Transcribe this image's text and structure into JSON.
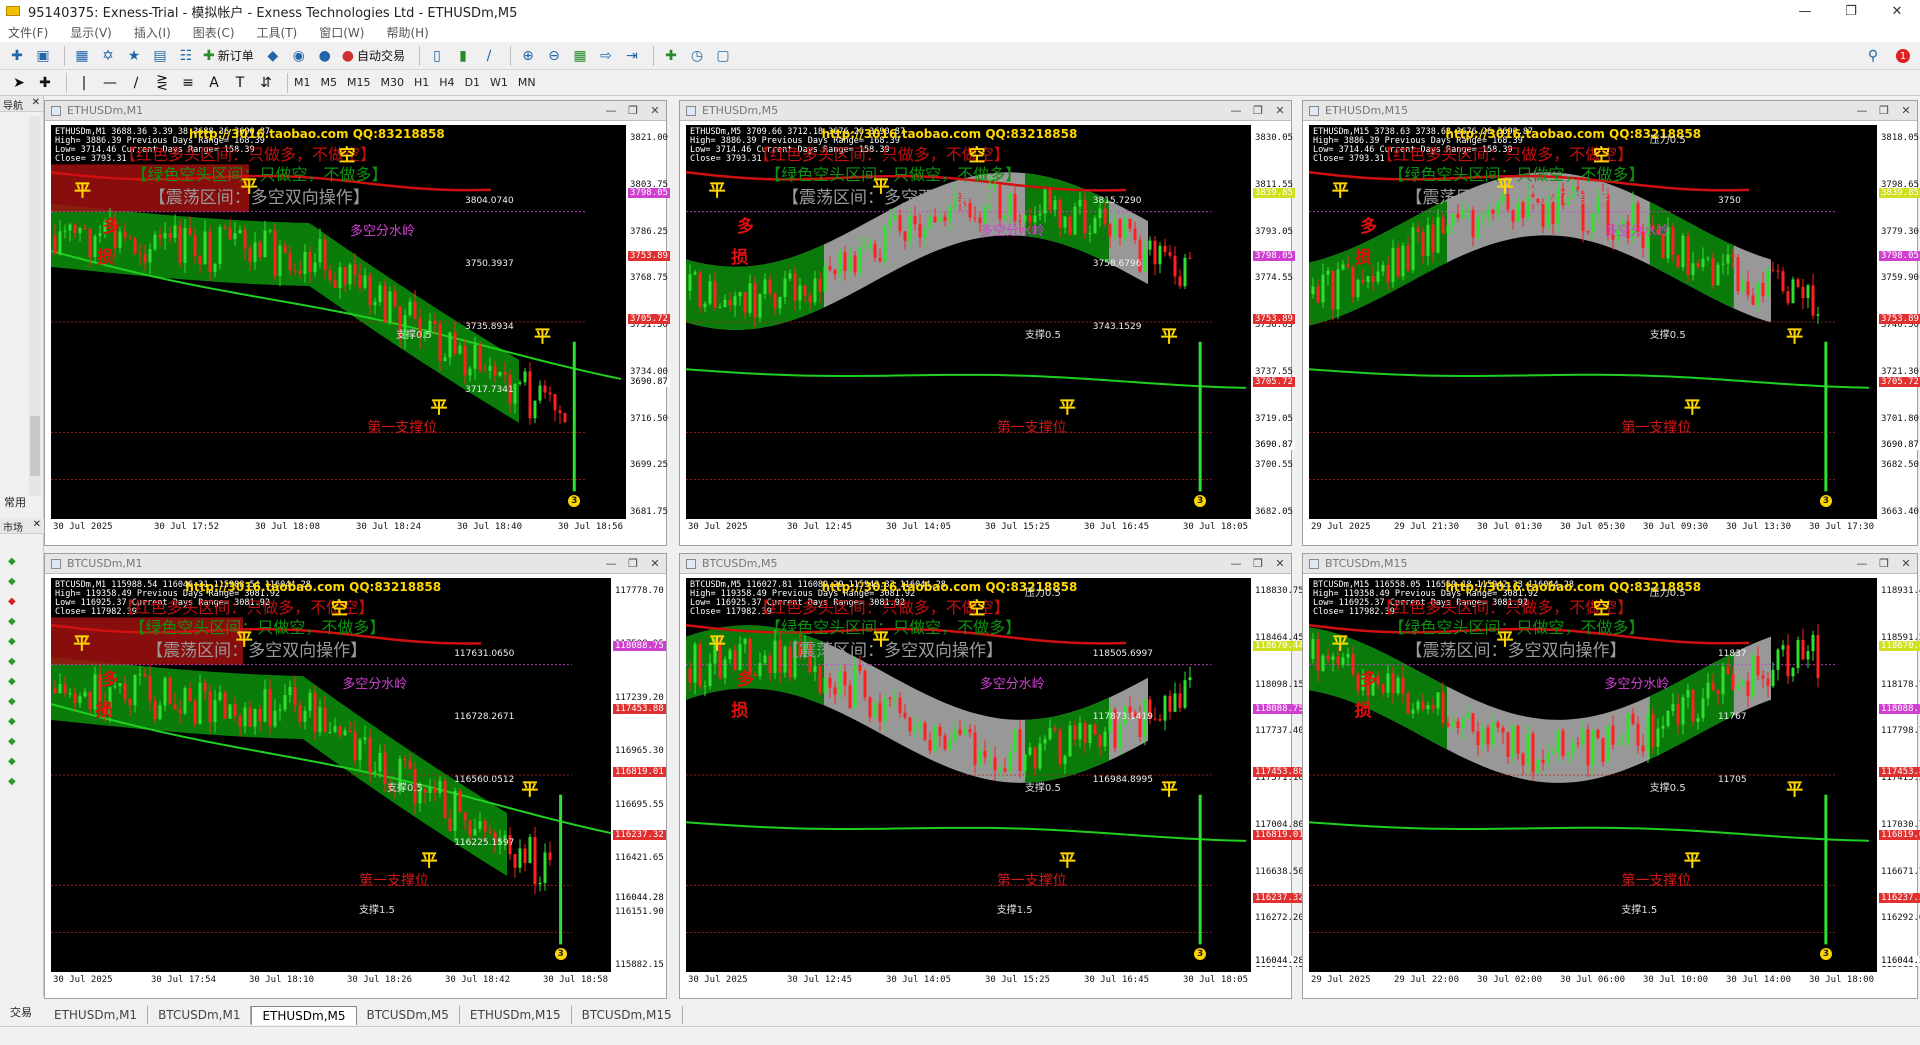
{
  "window": {
    "title": "95140375: Exness-Trial - 模拟帐户 - Exness Technologies Ltd - ETHUSDm,M5"
  },
  "menu": [
    "文件(F)",
    "显示(V)",
    "插入(I)",
    "图表(C)",
    "工具(T)",
    "窗口(W)",
    "帮助(H)"
  ],
  "toolbar": {
    "new_order": "新订单",
    "auto_trade": "自动交易",
    "timeframes": [
      "M1",
      "M5",
      "M15",
      "M30",
      "H1",
      "H4",
      "D1",
      "W1",
      "MN"
    ],
    "notif_count": "1"
  },
  "left": {
    "nav": "导航",
    "common": "常用",
    "market": "市场",
    "trade_tab": "交易"
  },
  "tabs": [
    "ETHUSDm,M1",
    "BTCUSDm,M1",
    "ETHUSDm,M5",
    "BTCUSDm,M5",
    "ETHUSDm,M15",
    "BTCUSDm,M15"
  ],
  "active_tab": "ETHUSDm,M5",
  "common": {
    "url": "http://3016.taobao.com QQ:83218858",
    "red_zone": "【红色多头区间：只做多，不做空】",
    "green_zone": "【绿色空头区间：只做空，不做多】",
    "range_zone": "【震荡区间：多空双向操作】",
    "ping": "平",
    "duo": "多",
    "kong": "空",
    "sun": "损",
    "support05": "支撑0.5",
    "support15": "支撑1.5",
    "pressure05": "压力0.5",
    "first_support": "第一支撑位",
    "ridge": "多空分水岭"
  },
  "charts": [
    {
      "name": "ETHUSDm,M1",
      "ohlc": [
        "ETHUSDm,M1  3688.36 3.39 38 3688.36 3690.87",
        "High= 3886.39   Previous Days Range= 168.39",
        "Low= 3714.46   Current Days Range= 158.39",
        "Close= 3793.31"
      ],
      "yticks": [
        "3821.00",
        "3803.75",
        "3786.25",
        "3768.75",
        "3751.50",
        "3734.00",
        "3716.50",
        "3699.25",
        "3681.75"
      ],
      "xticks": [
        "30 Jul 2025",
        "30 Jul 17:52",
        "30 Jul 18:08",
        "30 Jul 18:24",
        "30 Jul 18:40",
        "30 Jul 18:56"
      ],
      "tags": [
        {
          "v": "3798.05",
          "c": "#d040d0"
        },
        {
          "v": "3753.89",
          "c": "#e03030"
        },
        {
          "v": "3705.72",
          "c": "#e03030"
        },
        {
          "v": "3690.87",
          "c": "#ffffff"
        }
      ],
      "prices": [
        "3804.0740",
        "3750.3937",
        "3735.8934",
        "3717.7341"
      ]
    },
    {
      "name": "ETHUSDm,M5",
      "ohlc": [
        "ETHUSDm,M5  3709.66 3712.18 3676.26 3690.87",
        "High= 3886.39   Previous Days Range= 168.39",
        "Low= 3714.46   Current Days Range= 158.39",
        "Close= 3793.31"
      ],
      "yticks": [
        "3830.05",
        "3811.55",
        "3793.05",
        "3774.55",
        "3756.05",
        "3737.55",
        "3719.05",
        "3700.55",
        "3682.05"
      ],
      "xticks": [
        "30 Jul 2025",
        "30 Jul 12:45",
        "30 Jul 14:05",
        "30 Jul 15:25",
        "30 Jul 16:45",
        "30 Jul 18:05"
      ],
      "tags": [
        {
          "v": "3839.85",
          "c": "#d0e020"
        },
        {
          "v": "3798.05",
          "c": "#d040d0"
        },
        {
          "v": "3753.89",
          "c": "#e03030"
        },
        {
          "v": "3705.72",
          "c": "#e03030"
        },
        {
          "v": "3690.87",
          "c": "#ffffff"
        }
      ],
      "prices": [
        "3815.7290",
        "3758.6796",
        "3743.1529"
      ]
    },
    {
      "name": "ETHUSDm,M15",
      "ohlc": [
        "ETHUSDm,M15  3738.63 3738.63 3676.26 3690.87",
        "High= 3886.39   Previous Days Range= 168.39",
        "Low= 3714.46   Current Days Range= 158.39",
        "Close= 3793.31"
      ],
      "yticks": [
        "3818.05",
        "3798.65",
        "3779.30",
        "3759.90",
        "3740.50",
        "3721.30",
        "3701.80",
        "3682.50",
        "3663.40"
      ],
      "xticks": [
        "29 Jul 2025",
        "29 Jul 21:30",
        "30 Jul 01:30",
        "30 Jul 05:30",
        "30 Jul 09:30",
        "30 Jul 13:30",
        "30 Jul 17:30"
      ],
      "tags": [
        {
          "v": "3839.85",
          "c": "#d0e020"
        },
        {
          "v": "3798.05",
          "c": "#d040d0"
        },
        {
          "v": "3753.89",
          "c": "#e03030"
        },
        {
          "v": "3705.72",
          "c": "#e03030"
        },
        {
          "v": "3690.87",
          "c": "#ffffff"
        }
      ],
      "prices": [
        "3750"
      ]
    },
    {
      "name": "BTCUSDm,M1",
      "ohlc": [
        "BTCUSDm,M1  115988.54 116046.31 115988.54 116044.28",
        "High= 119358.49   Previous Days Range= 3081.92",
        "Low= 116925.37   Current Days Range= 3081.92",
        "Close= 117982.39"
      ],
      "yticks": [
        "117778.70",
        "117508.95",
        "117239.20",
        "116965.30",
        "116695.55",
        "116421.65",
        "116151.90",
        "115882.15"
      ],
      "xticks": [
        "30 Jul 2025",
        "30 Jul 17:54",
        "30 Jul 18:10",
        "30 Jul 18:26",
        "30 Jul 18:42",
        "30 Jul 18:58"
      ],
      "tags": [
        {
          "v": "118088.75",
          "c": "#d040d0"
        },
        {
          "v": "117453.88",
          "c": "#e03030"
        },
        {
          "v": "116819.01",
          "c": "#e03030"
        },
        {
          "v": "116237.32",
          "c": "#e03030"
        },
        {
          "v": "116044.28",
          "c": "#ffffff"
        }
      ],
      "prices": [
        "117631.0650",
        "116728.2671",
        "116560.0512",
        "116225.1597"
      ]
    },
    {
      "name": "BTCUSDm,M5",
      "ohlc": [
        "BTCUSDm,M5  116027.81 116089.29 115942.33 116044.28",
        "High= 119358.49   Previous Days Range= 3081.92",
        "Low= 116925.37   Current Days Range= 3081.92",
        "Close= 117982.39"
      ],
      "yticks": [
        "118830.75",
        "118464.45",
        "118098.15",
        "117737.40",
        "117371.10",
        "117004.80",
        "116638.50",
        "116272.20",
        "115911.45"
      ],
      "xticks": [
        "30 Jul 2025",
        "30 Jul 12:45",
        "30 Jul 14:05",
        "30 Jul 15:25",
        "30 Jul 16:45",
        "30 Jul 18:05"
      ],
      "tags": [
        {
          "v": "118670.44",
          "c": "#d0e020"
        },
        {
          "v": "118088.75",
          "c": "#d040d0"
        },
        {
          "v": "117453.88",
          "c": "#e03030"
        },
        {
          "v": "116819.01",
          "c": "#e03030"
        },
        {
          "v": "116237.32",
          "c": "#e03030"
        },
        {
          "v": "116044.28",
          "c": "#ffffff"
        }
      ],
      "prices": [
        "118505.6997",
        "117873.1419",
        "116984.8995"
      ]
    },
    {
      "name": "BTCUSDm,M15",
      "ohlc": [
        "BTCUSDm,M15  116558.05 116559.18 115942.33 116044.28",
        "High= 119358.49   Previous Days Range= 3081.92",
        "Low= 116925.37   Current Days Range= 3081.92",
        "Close= 117982.39"
      ],
      "yticks": [
        "118931.45",
        "118591.25",
        "118178.75",
        "117798.70",
        "117415.35",
        "117030.75",
        "116671.70",
        "116292.05",
        "115918.45"
      ],
      "xticks": [
        "29 Jul 2025",
        "29 Jul 22:00",
        "30 Jul 02:00",
        "30 Jul 06:00",
        "30 Jul 10:00",
        "30 Jul 14:00",
        "30 Jul 18:00"
      ],
      "tags": [
        {
          "v": "118670.44",
          "c": "#d0e020"
        },
        {
          "v": "118088.75",
          "c": "#d040d0"
        },
        {
          "v": "117453.88",
          "c": "#e03030"
        },
        {
          "v": "116819.01",
          "c": "#e03030"
        },
        {
          "v": "116237.32",
          "c": "#e03030"
        },
        {
          "v": "116044.28",
          "c": "#ffffff"
        }
      ],
      "prices": [
        "11837",
        "11767",
        "11705"
      ]
    }
  ]
}
